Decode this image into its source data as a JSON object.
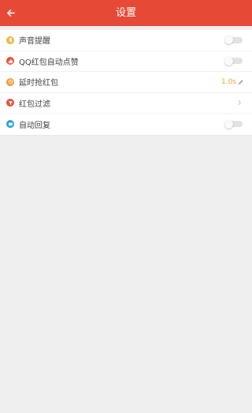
{
  "header": {
    "title": "设置"
  },
  "settings": {
    "items": [
      {
        "label": "声音提醒",
        "control": "toggle",
        "enabled": false,
        "icon": "bell-icon",
        "icon_color": "#f5b33c"
      },
      {
        "label": "QQ红包自动点赞",
        "control": "toggle",
        "enabled": false,
        "icon": "thumbs-up-icon",
        "icon_color": "#e6533c"
      },
      {
        "label": "延时抢红包",
        "control": "value",
        "value": "1.0s",
        "icon": "clock-icon",
        "icon_color": "#ef9a2f"
      },
      {
        "label": "红包过滤",
        "control": "chevron",
        "icon": "filter-icon",
        "icon_color": "#e6533c"
      },
      {
        "label": "自动回复",
        "control": "toggle",
        "enabled": false,
        "icon": "chat-icon",
        "icon_color": "#2aa3d6"
      }
    ]
  },
  "colors": {
    "header": "#e64a36",
    "background": "#efefef",
    "value_accent": "#f0a830"
  }
}
